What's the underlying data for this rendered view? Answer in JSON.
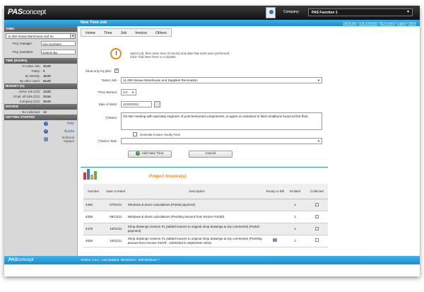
{
  "app": {
    "logo_main": "PAS",
    "logo_sub": "concept"
  },
  "header": {
    "company_label": "Company:",
    "company_value": "PAS Function 1",
    "page_title": "New Time-Job",
    "links": [
      "Admin site",
      "Ana Gonzalez",
      "My Account",
      "Logout",
      "Home"
    ]
  },
  "sidebar": {
    "jobs_head": "JOBS",
    "job_value": "11-350-Sanaa Warehouse and Su",
    "proj_manager_label": "Proj. manager:",
    "proj_manager_value": "Ana Gonzalez",
    "proj_members_label": "Proj. members:",
    "proj_members_value": "System Ba",
    "time_head": "TIME (HOURS)",
    "time_rows": [
      {
        "label": "In Active Job:",
        "value": "10.00"
      },
      {
        "label": "Today:",
        "value": "0"
      },
      {
        "label": "By Weekly:",
        "value": "16.00"
      },
      {
        "label": "By other users:",
        "value": "54.00"
      }
    ],
    "budget_head": "BUDGET (%)",
    "budget_rows": [
      {
        "label": "Active Job (G3):",
        "value": "13.00"
      },
      {
        "label": "Empl. all Jobs (G2):",
        "value": "33.54"
      },
      {
        "label": "Company (G1):",
        "value": "29.00"
      }
    ],
    "invoice_head": "INVOICE",
    "invoice_rows": [
      {
        "label": "No Collected:",
        "value": "13"
      }
    ],
    "getting_started_head": "GETTING STARTED",
    "support": {
      "help": "Help",
      "ayuda": "Ayuda",
      "technical": "Technical",
      "support": "Support"
    }
  },
  "tabs": [
    "Home",
    "Time",
    "Job",
    "Invoice",
    "Others"
  ],
  "form": {
    "instruction_1": "Select job, then enter time (in hours) and date that work were performed.",
    "instruction_2": "Click 'Add New Time' to complete.",
    "show_only_my_jobs_label": "Show only my jobs:",
    "select_job_label": "*Select Job:",
    "select_job_value": "11-350-Sanaa Warehouse and Supplies Renovation",
    "time_worked_label": "*Time Worked:",
    "time_worked_value": "3.0",
    "date_of_work_label": "Date of Work:",
    "date_of_work_value": "11/22/2011",
    "notes_label": "(*)Notes:",
    "notes_value": "On-site meeting with specialty engineer of post-tensioned components, to  agree on solutions to field conditions found at first floor.",
    "generate_invoice_label": "Generate Invoice Hourly Fees",
    "select_task_label": "(*)Select Task:",
    "select_task_value": "",
    "add_button": "Add New Time",
    "cancel_button": "Cancel"
  },
  "invoices": {
    "title": "Project Invoice(s)",
    "columns": [
      "Number",
      "Date Created",
      "Description",
      "Ready to Bill",
      "Emitted",
      "Collected"
    ],
    "rows": [
      {
        "number": "4450",
        "date": "07/01/11",
        "description": "Windows & doors calculations (Partial payment)",
        "ready": false,
        "emitted": "1",
        "collected": true
      },
      {
        "number": "4348",
        "date": "09/13/11",
        "description": "Windows & doors calculations (Pending amount from Invoice #4150)",
        "ready": false,
        "emitted": "1",
        "collected": true
      },
      {
        "number": "4478",
        "date": "10/21/11",
        "description": "Shop drawings revision #1 (added louvers to original shop drawings & city comments) (Partial payment)",
        "ready": false,
        "emitted": "1",
        "collected": true
      },
      {
        "number": "4529",
        "date": "10/21/11",
        "description": "Shop drawings revision #1 (added louvers to original shop drawings & city comments) (Pending amount from Invoice #4478 - submitted in September 2011)",
        "ready": true,
        "emitted": "1",
        "collected": false
      }
    ]
  },
  "footer": {
    "logo_main": "PAS",
    "logo_sub": "concept",
    "version": "Version: 3.0.0 - Last Updated: 06/15/2013 - SSE:Windows 7"
  },
  "colors": {
    "accent": "#1a8fd0",
    "invoice_title": "#e58a2a",
    "topbar": "#111111"
  }
}
